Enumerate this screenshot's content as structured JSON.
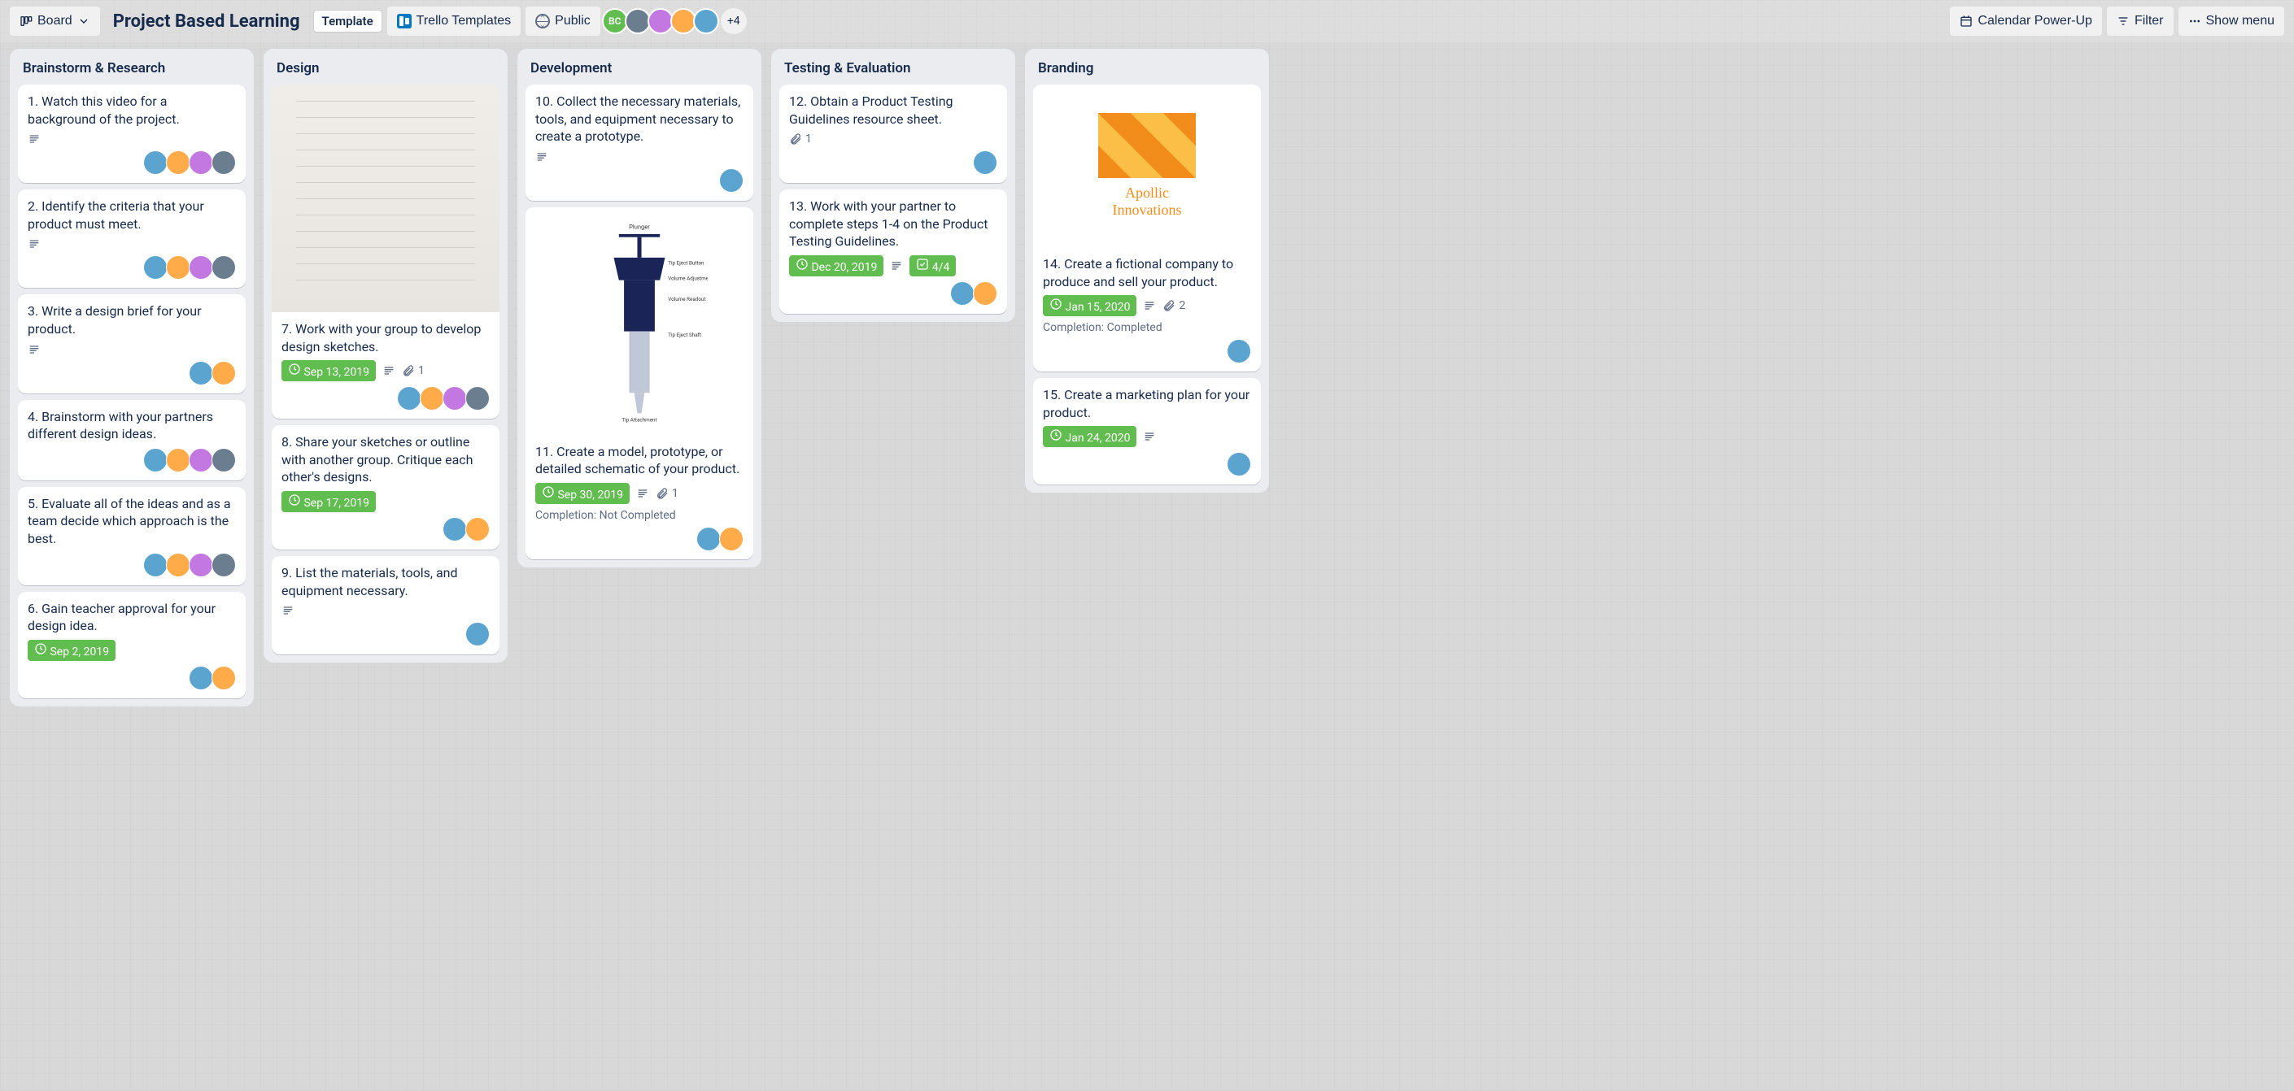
{
  "header": {
    "view_label": "Board",
    "title": "Project Based Learning",
    "template_label": "Template",
    "workspace_label": "Trello Templates",
    "visibility_label": "Public",
    "members_more": "+4",
    "calendar_label": "Calendar Power-Up",
    "filter_label": "Filter",
    "show_menu_label": "Show menu"
  },
  "lists": [
    {
      "title": "Brainstorm & Research",
      "cards": [
        {
          "title": "1. Watch this video for a background of the project.",
          "desc": true,
          "members": 4
        },
        {
          "title": "2. Identify the criteria that your product must meet.",
          "desc": true,
          "members": 4
        },
        {
          "title": "3. Write a design brief for your product.",
          "desc": true,
          "members": 2
        },
        {
          "title": "4. Brainstorm with your partners different design ideas.",
          "members": 4
        },
        {
          "title": "5. Evaluate all of the ideas and as a team decide which approach is the best.",
          "members": 4
        },
        {
          "title": "6. Gain teacher approval for your design idea.",
          "date": "Sep 2, 2019",
          "members": 2
        }
      ]
    },
    {
      "title": "Design",
      "cards": [
        {
          "cover": "sketch",
          "title": "7. Work with your group to develop design sketches.",
          "date": "Sep 13, 2019",
          "desc": true,
          "attachments": 1,
          "members": 4
        },
        {
          "title": "8. Share your sketches or outline with another group. Critique each other's designs.",
          "date": "Sep 17, 2019",
          "members": 2
        },
        {
          "title": "9. List the materials, tools, and equipment necessary.",
          "desc": true,
          "members": 1
        }
      ]
    },
    {
      "title": "Development",
      "cards": [
        {
          "title": "10. Collect the necessary materials, tools, and equipment necessary to create a prototype.",
          "desc": true,
          "members": 1
        },
        {
          "cover": "pipette",
          "title": "11. Create a model, prototype, or detailed schematic of your product.",
          "date": "Sep 30, 2019",
          "desc": true,
          "attachments": 1,
          "completion": "Completion: Not Completed",
          "members": 2
        }
      ]
    },
    {
      "title": "Testing & Evaluation",
      "cards": [
        {
          "title": "12. Obtain a Product Testing Guidelines resource sheet.",
          "attachments": 1,
          "members": 1
        },
        {
          "title": "13. Work with your partner to complete steps 1-4 on the Product Testing Guidelines.",
          "date": "Dec 20, 2019",
          "desc": true,
          "checklist": "4/4",
          "members": 2
        }
      ]
    },
    {
      "title": "Branding",
      "cards": [
        {
          "cover": "apollic",
          "cover_text1": "Apollic",
          "cover_text2": "Innovations",
          "title": "14. Create a fictional company to produce and sell your product.",
          "date": "Jan 15, 2020",
          "desc": true,
          "attachments": 2,
          "completion": "Completion: Completed",
          "members": 1
        },
        {
          "title": "15. Create a marketing plan for your product.",
          "date": "Jan 24, 2020",
          "desc": true,
          "members": 1
        }
      ]
    }
  ]
}
